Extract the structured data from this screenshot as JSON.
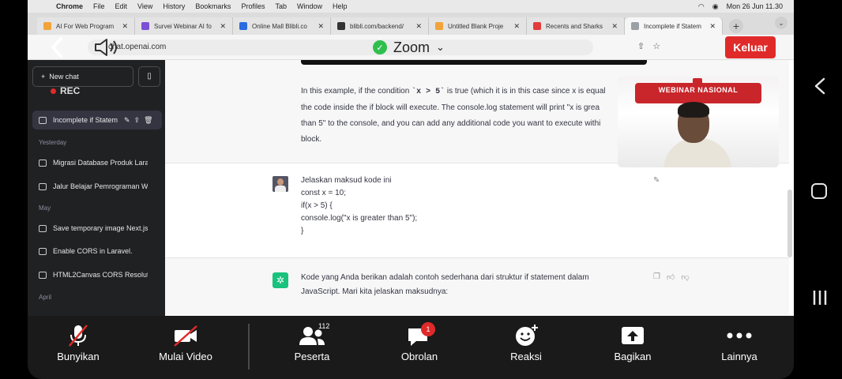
{
  "mac_menubar": {
    "app": "Chrome",
    "items": [
      "File",
      "Edit",
      "View",
      "History",
      "Bookmarks",
      "Profiles",
      "Tab",
      "Window",
      "Help"
    ],
    "datetime": "Mon 26 Jun  11.30"
  },
  "browser_tabs": [
    {
      "title": "AI For Web Program",
      "color": "#f2a33a"
    },
    {
      "title": "Survei Webinar AI fo",
      "color": "#7b4fd6"
    },
    {
      "title": "Online Mall Blibli.co",
      "color": "#2a6be0"
    },
    {
      "title": "blibli.com/backend/",
      "color": "#333333"
    },
    {
      "title": "Untitled Blank Proje",
      "color": "#f2a33a"
    },
    {
      "title": "Recents and Sharks",
      "color": "#e23b3b"
    },
    {
      "title": "Incomplete if Statem",
      "color": "#9aa0a6",
      "active": true
    }
  ],
  "address": {
    "url": "chat.openai.com"
  },
  "zoom": {
    "meeting_label": "Zoom",
    "leave_label": "Keluar",
    "rec_label": "REC"
  },
  "sidebar": {
    "new_chat": "New chat",
    "active_item": "Incomplete if Statem",
    "sections": [
      {
        "label": "Yesterday",
        "items": [
          "Migrasi Database Produk Lara",
          "Jalur Belajar Pemrograman We"
        ]
      },
      {
        "label": "May",
        "items": [
          "Save temporary image Next.js",
          "Enable CORS in Laravel.",
          "HTML2Canvas CORS Resoluti"
        ]
      },
      {
        "label": "April",
        "items": []
      }
    ]
  },
  "chat": {
    "ai_prev": {
      "line1_pre": "In this example, if the condition ",
      "line1_code": "`x > 5`",
      "line1_post": " is true (which it is in this case since x is equal",
      "line2": "the code inside the if block will execute. The console.log statement will print \"x is grea",
      "line3": "than 5\" to the console, and you can add any additional code you want to execute withi",
      "line4": "block."
    },
    "user_msg": [
      "Jelaskan maksud kode ini",
      "const x = 10;",
      "if(x > 5) {",
      "console.log(\"x is greater than 5\");",
      "}"
    ],
    "ai_reply": [
      "Kode yang Anda berikan adalah contoh sederhana dari struktur if statement dalam",
      "JavaScript. Mari kita jelaskan maksudnya:"
    ]
  },
  "webinar_tile": {
    "banner_title": "WEBINAR NASIONAL"
  },
  "toolbar": {
    "mute": "Bunyikan",
    "video": "Mulai Video",
    "participants": "Peserta",
    "participants_count": "112",
    "chat": "Obrolan",
    "chat_unread": "1",
    "reactions": "Reaksi",
    "share": "Bagikan",
    "more": "Lainnya"
  }
}
